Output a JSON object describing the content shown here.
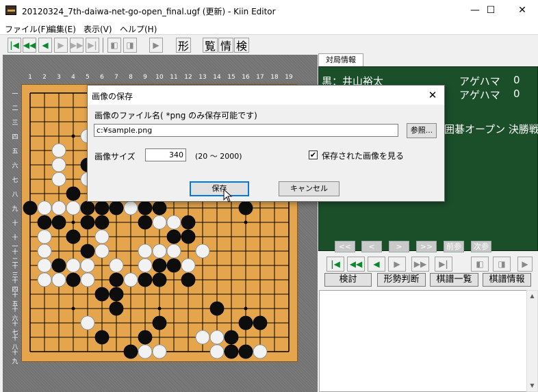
{
  "window": {
    "title": "20120324_7th-daiwa-net-go-open_final.ugf (更新) - Kiin Editor",
    "minimize": "—",
    "maximize": "☐",
    "close": "✕"
  },
  "menu": [
    "ファイル(F)",
    "編集(E)",
    "表示(V)",
    "ヘルプ(H)"
  ],
  "toolbar": {
    "kanji": [
      "形",
      "覧",
      "情",
      "検"
    ]
  },
  "board": {
    "columns": [
      "1",
      "2",
      "3",
      "4",
      "5",
      "6",
      "7",
      "8",
      "9",
      "10",
      "11",
      "12",
      "13",
      "14",
      "15",
      "16",
      "17",
      "18",
      "19"
    ],
    "rows": [
      "一",
      "二",
      "三",
      "四",
      "五",
      "六",
      "七",
      "八",
      "九",
      "十",
      "十一",
      "十二",
      "十三",
      "十四",
      "十五",
      "十六",
      "十七",
      "十八",
      "十九"
    ],
    "black": [
      [
        4,
        8
      ],
      [
        5,
        6
      ],
      [
        5,
        9
      ],
      [
        5,
        10
      ],
      [
        4,
        11
      ],
      [
        1,
        9
      ],
      [
        3,
        10
      ],
      [
        6,
        9
      ],
      [
        7,
        9
      ],
      [
        9,
        9
      ],
      [
        10,
        9
      ],
      [
        16,
        9
      ],
      [
        2,
        10
      ],
      [
        6,
        10
      ],
      [
        9,
        10
      ],
      [
        12,
        10
      ],
      [
        4,
        11
      ],
      [
        5,
        12
      ],
      [
        11,
        11
      ],
      [
        12,
        11
      ],
      [
        3,
        13
      ],
      [
        10,
        13
      ],
      [
        11,
        13
      ],
      [
        4,
        14
      ],
      [
        7,
        14
      ],
      [
        9,
        14
      ],
      [
        10,
        14
      ],
      [
        12,
        14
      ],
      [
        6,
        15
      ],
      [
        7,
        15
      ],
      [
        7,
        16
      ],
      [
        14,
        16
      ],
      [
        10,
        17
      ],
      [
        16,
        17
      ],
      [
        17,
        17
      ],
      [
        6,
        18
      ],
      [
        9,
        18
      ],
      [
        15,
        18
      ],
      [
        8,
        19
      ],
      [
        15,
        19
      ],
      [
        16,
        19
      ],
      [
        16,
        20
      ]
    ],
    "white": [
      [
        5,
        4
      ],
      [
        3,
        5
      ],
      [
        6,
        5
      ],
      [
        3,
        6
      ],
      [
        5,
        6
      ],
      [
        3,
        7
      ],
      [
        5,
        7
      ],
      [
        2,
        9
      ],
      [
        3,
        9
      ],
      [
        4,
        9
      ],
      [
        5,
        9
      ],
      [
        8,
        9
      ],
      [
        10,
        9
      ],
      [
        3,
        10
      ],
      [
        5,
        10
      ],
      [
        6,
        10
      ],
      [
        10,
        10
      ],
      [
        11,
        10
      ],
      [
        2,
        11
      ],
      [
        4,
        11
      ],
      [
        6,
        11
      ],
      [
        2,
        12
      ],
      [
        6,
        12
      ],
      [
        9,
        12
      ],
      [
        10,
        12
      ],
      [
        11,
        12
      ],
      [
        13,
        12
      ],
      [
        2,
        13
      ],
      [
        4,
        13
      ],
      [
        5,
        13
      ],
      [
        7,
        13
      ],
      [
        9,
        13
      ],
      [
        12,
        13
      ],
      [
        2,
        14
      ],
      [
        3,
        14
      ],
      [
        5,
        14
      ],
      [
        8,
        14
      ],
      [
        5,
        17
      ],
      [
        13,
        18
      ],
      [
        14,
        18
      ],
      [
        9,
        19
      ],
      [
        10,
        19
      ],
      [
        14,
        19
      ],
      [
        16,
        19
      ],
      [
        17,
        19
      ]
    ],
    "marked": [
      [
        16,
        10
      ]
    ]
  },
  "right": {
    "tab": "対局情報",
    "black_label": "黒：井山裕太",
    "agehama1_label": "アゲハマ",
    "agehama1_value": "0",
    "agehama2_label": "アゲハマ",
    "agehama2_value": "0",
    "event": "囲碁オープン 決勝戦",
    "nav": [
      "<<",
      "<",
      ">",
      ">>",
      "前参",
      "次参"
    ],
    "buttons": [
      "検討",
      "形勢判断",
      "棋譜一覧",
      "棋譜情報"
    ]
  },
  "dialog": {
    "title": "画像の保存",
    "close": "✕",
    "file_label": "画像のファイル名( *png のみ保存可能です)",
    "file_value": "c:¥sample.png",
    "browse": "参照...",
    "size_label": "画像サイズ",
    "size_value": "340",
    "range": "(20 〜 2000)",
    "view_check": "✔",
    "view_label": "保存された画像を見る",
    "save": "保存",
    "cancel": "キャンセル"
  },
  "colors": {
    "info_bg": "#1a4f2a",
    "board": "#e5a54c",
    "accent": "#0078d7",
    "nav_green": "#0a8a2a"
  }
}
